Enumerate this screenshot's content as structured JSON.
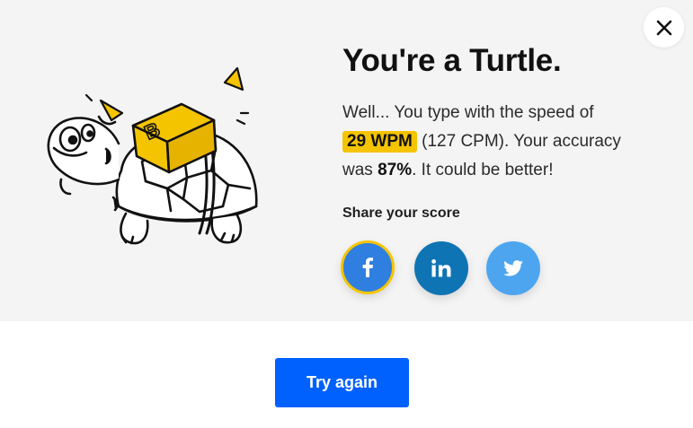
{
  "result": {
    "title": "You're a Turtle.",
    "desc_prefix": "Well... You type with the speed of",
    "wpm": "29 WPM",
    "cpm": "(127 CPM). Your accuracy",
    "accuracy_prefix": "was",
    "accuracy": "87%",
    "accuracy_suffix": ". It could be better!"
  },
  "share": {
    "label": "Share your score",
    "buttons": [
      {
        "network": "facebook",
        "icon": "facebook-icon",
        "glyph": "f",
        "color": "#2f7fe0",
        "selected": true
      },
      {
        "network": "linkedin",
        "icon": "linkedin-icon",
        "glyph": "in",
        "color": "#0f74b4"
      },
      {
        "network": "twitter",
        "icon": "twitter-icon",
        "glyph": "",
        "color": "#4da5ef"
      }
    ]
  },
  "actions": {
    "try_again_label": "Try again"
  },
  "illustration": {
    "icon": "turtle-with-keycap-illustration",
    "keycap_letter": "B"
  },
  "colors": {
    "panel_bg": "#f4f4f4",
    "accent_yellow": "#f5c400",
    "primary_blue": "#0061ff"
  }
}
